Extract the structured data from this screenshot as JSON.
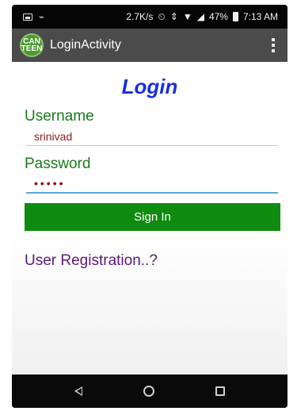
{
  "status_bar": {
    "network_speed": "2.7K/s",
    "battery": "47%",
    "time": "7:13 AM"
  },
  "action_bar": {
    "logo_text_top": "CAN",
    "logo_text_bottom": "TEEN",
    "title": "LoginActivity"
  },
  "form": {
    "heading": "Login",
    "username_label": "Username",
    "username_value": "srinivad",
    "password_label": "Password",
    "password_value": "•••••",
    "signin_label": "Sign In",
    "registration_link": "User Registration..?"
  }
}
